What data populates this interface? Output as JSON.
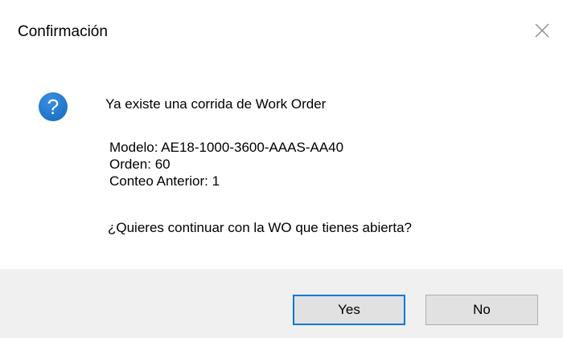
{
  "window": {
    "title": "Confirmación"
  },
  "message": {
    "headline": "Ya existe una corrida de Work Order",
    "lines": [
      "Modelo: AE18-1000-3600-AAAS-AA40",
      "Orden: 60",
      "Conteo Anterior: 1"
    ],
    "question": "¿Quieres continuar con la WO que tienes abierta?"
  },
  "icons": {
    "message_icon": "question-icon",
    "close_icon": "close-icon"
  },
  "buttons": {
    "yes_label": "Yes",
    "no_label": "No"
  },
  "colors": {
    "icon_blue": "#1a6fc4",
    "focus_border": "#0078d7",
    "footer_bg": "#f0f0f0",
    "button_bg": "#e1e1e1"
  }
}
